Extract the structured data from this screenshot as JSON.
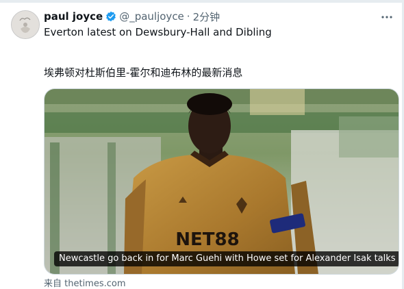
{
  "tweet": {
    "author_name": "paul joyce",
    "handle": "@_pauljoyce",
    "separator": "·",
    "time": "2分钟",
    "text": "Everton latest on Dewsbury-Hall and Dibling",
    "translation": "埃弗顿对杜斯伯里-霍尔和迪布林的最新消息"
  },
  "card": {
    "caption": "Newcastle go back in for Marc Guehi with Howe set for Alexander Isak talks",
    "jersey_sponsor": "NET88",
    "source": "来自 thetimes.com"
  },
  "icons": {
    "verified": "verified-badge-icon",
    "more": "more-options-icon"
  },
  "colors": {
    "verified_blue": "#1d9bf0",
    "text_secondary": "#536471",
    "jersey": "#b8893a"
  }
}
